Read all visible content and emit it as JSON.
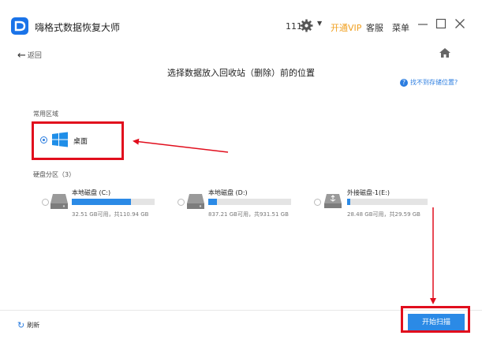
{
  "app": {
    "title": "嗨格式数据恢复大师",
    "brand_color": "#1a73e8"
  },
  "header": {
    "user": "111",
    "vip_label": "开通VIP",
    "service_label": "客服",
    "menu_label": "菜单",
    "icons": [
      "gear-icon",
      "caret-down-icon",
      "minimize-icon",
      "maximize-icon",
      "close-icon"
    ]
  },
  "nav": {
    "back_label": "返回",
    "home_icon": "home-icon"
  },
  "page": {
    "title": "选择数据放入回收站（删除）前的位置",
    "help_link": "找不到存储位置?"
  },
  "common": {
    "section_label": "常用区域",
    "items": [
      {
        "label": "桌面",
        "selected": true,
        "icon": "windows-logo-icon"
      }
    ]
  },
  "disks": {
    "section_label": "硬盘分区（3）",
    "items": [
      {
        "name": "本地磁盘 (C:)",
        "size": "32.51 GB可用，共110.94 GB",
        "used_fraction": 0.71,
        "icon": "hard-drive-icon"
      },
      {
        "name": "本地磁盘 (D:)",
        "size": "837.21 GB可用，共931.51 GB",
        "used_fraction": 0.1,
        "icon": "hard-drive-icon"
      },
      {
        "name": "外接磁盘-1(E:)",
        "size": "28.48 GB可用，共29.59 GB",
        "used_fraction": 0.04,
        "icon": "usb-drive-icon"
      }
    ]
  },
  "footer": {
    "refresh_label": "刷新",
    "scan_label": "开始扫描"
  },
  "annotation_color": "#e10e1d"
}
